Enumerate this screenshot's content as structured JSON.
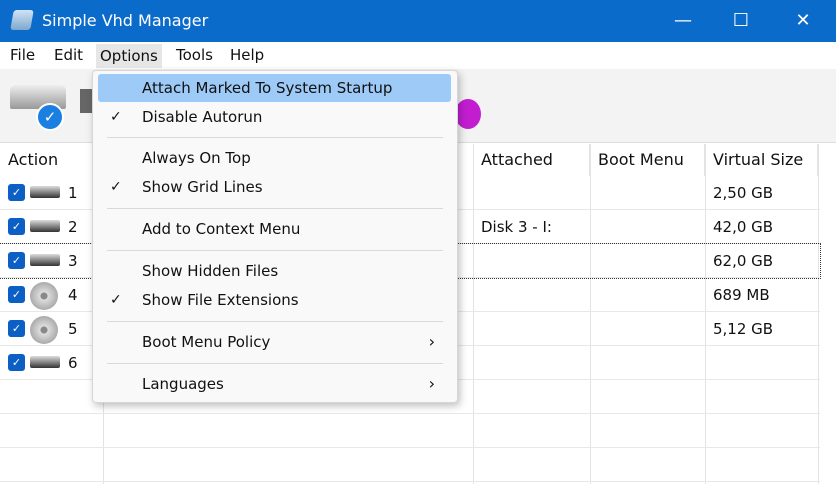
{
  "window": {
    "title": "Simple Vhd Manager",
    "minimize": "—",
    "maximize": "☐",
    "close": "✕"
  },
  "menubar": [
    "File",
    "Edit",
    "Options",
    "Tools",
    "Help"
  ],
  "columns": [
    "Action",
    "Attached",
    "Boot Menu",
    "Virtual Size"
  ],
  "rows": [
    {
      "num": "1",
      "icon": "hdd",
      "attached": "",
      "boot": "",
      "size": "2,50 GB"
    },
    {
      "num": "2",
      "icon": "hdd-attached",
      "attached": "Disk 3  -  I:",
      "boot": "",
      "size": "42,0 GB"
    },
    {
      "num": "3",
      "icon": "hdd",
      "attached": "",
      "boot": "",
      "size": "62,0 GB"
    },
    {
      "num": "4",
      "icon": "cd",
      "attached": "",
      "boot": "",
      "size": "689 MB"
    },
    {
      "num": "5",
      "icon": "cd",
      "attached": "",
      "boot": "",
      "size": "5,12 GB"
    },
    {
      "num": "6",
      "icon": "hdd-unknown",
      "attached": "",
      "boot": "",
      "size": ""
    }
  ],
  "options_menu": {
    "items": [
      {
        "label": "Attach Marked To System Startup",
        "checked": false
      },
      {
        "label": "Disable Autorun",
        "checked": true
      },
      {
        "label": "Always On Top",
        "checked": false
      },
      {
        "label": "Show Grid Lines",
        "checked": true
      },
      {
        "label": "Add to Context Menu",
        "checked": false
      },
      {
        "label": "Show Hidden Files",
        "checked": false
      },
      {
        "label": "Show File Extensions",
        "checked": true
      },
      {
        "label": "Boot Menu Policy",
        "submenu": true
      },
      {
        "label": "Languages",
        "submenu": true
      }
    ],
    "check": "✓",
    "submenu_arrow": "›"
  }
}
